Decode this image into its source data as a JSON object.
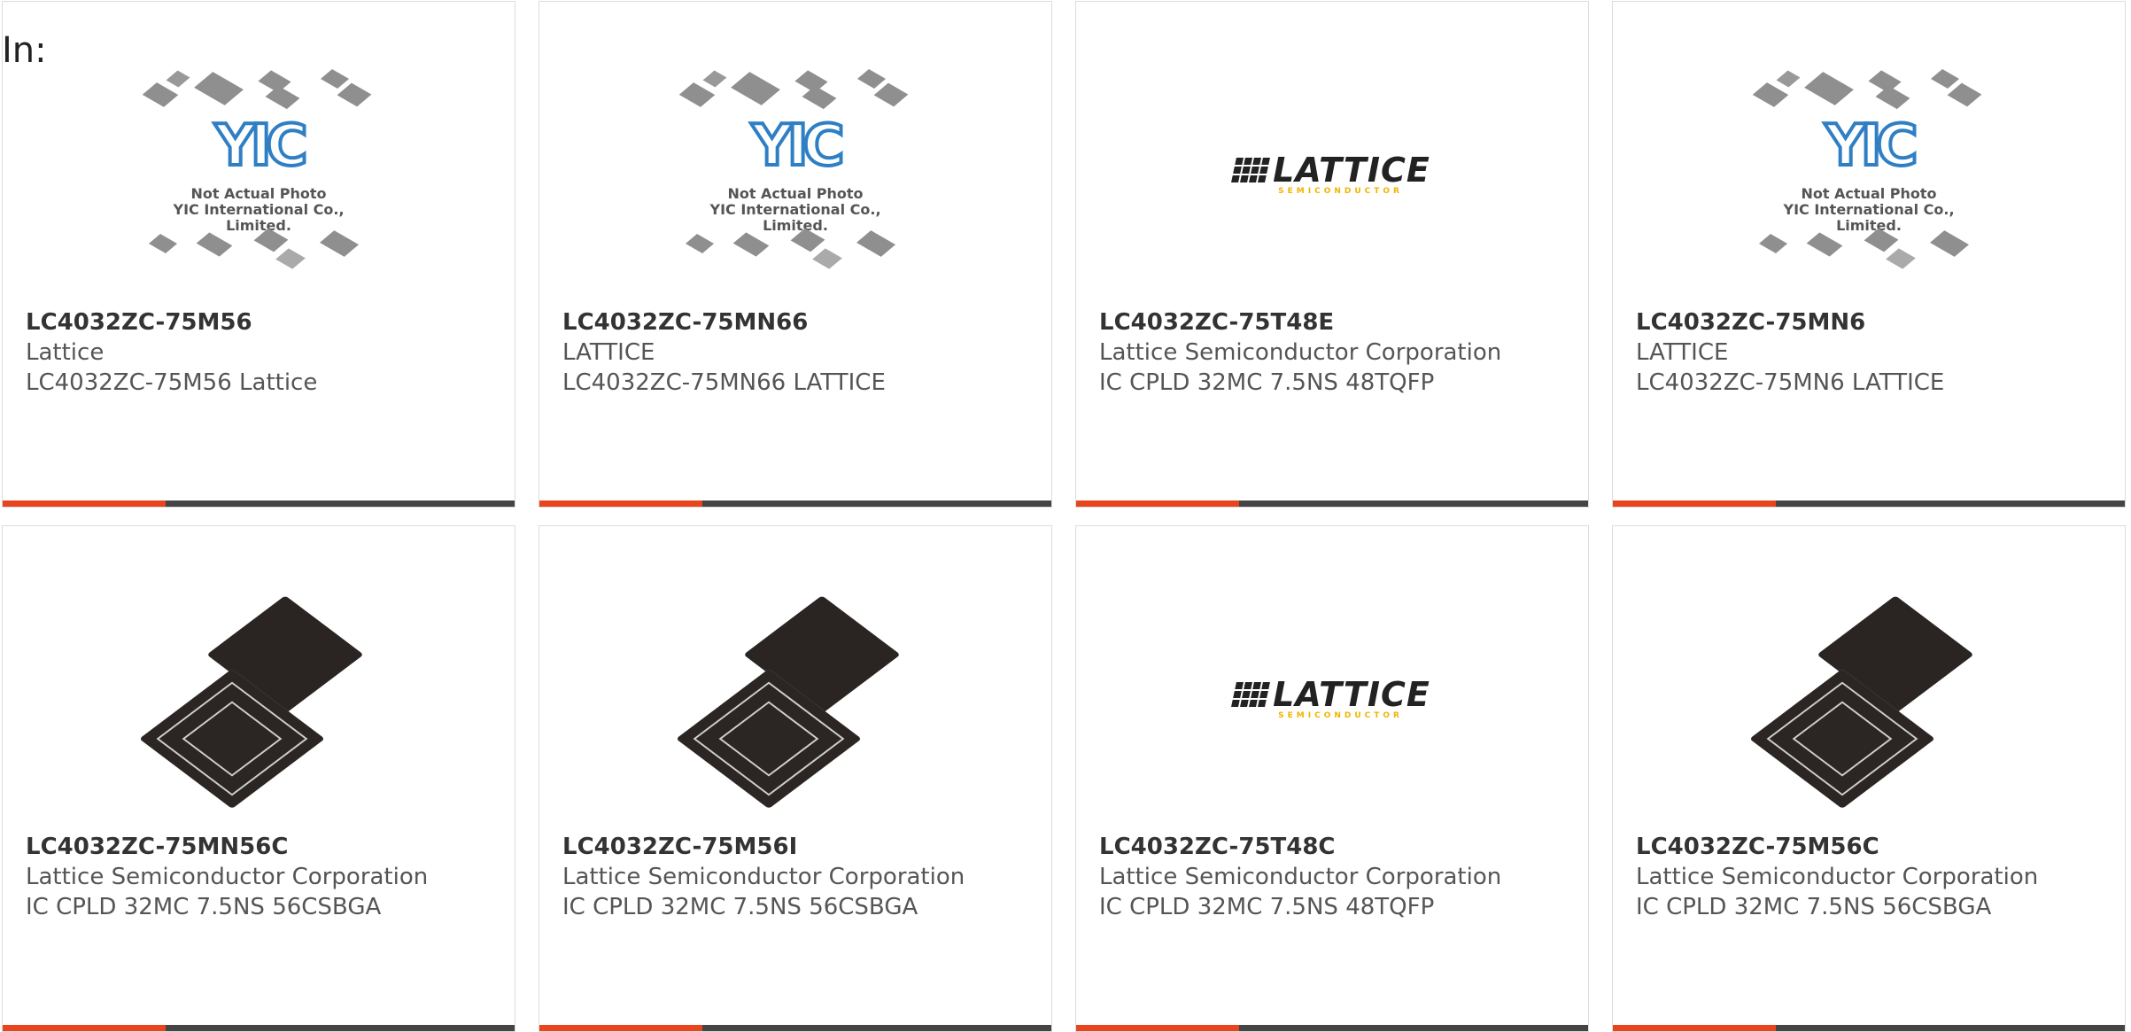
{
  "header": {
    "label": "In:"
  },
  "placeholder": {
    "line1": "Not Actual Photo",
    "line2": "YIC International Co., Limited."
  },
  "brand": {
    "accent": "#e8451e",
    "bar": "#444444",
    "lattice_yellow": "#f0b400"
  },
  "products": [
    {
      "part": "LC4032ZC-75M56",
      "maker": "Lattice",
      "desc": "LC4032ZC-75M56 Lattice",
      "image": "yic-placeholder"
    },
    {
      "part": "LC4032ZC-75MN66",
      "maker": "LATTICE",
      "desc": "LC4032ZC-75MN66 LATTICE",
      "image": "yic-placeholder"
    },
    {
      "part": "LC4032ZC-75T48E",
      "maker": "Lattice Semiconductor Corporation",
      "desc": "IC CPLD 32MC 7.5NS 48TQFP",
      "image": "lattice-logo"
    },
    {
      "part": "LC4032ZC-75MN6",
      "maker": "LATTICE",
      "desc": "LC4032ZC-75MN6 LATTICE",
      "image": "yic-placeholder"
    },
    {
      "part": "LC4032ZC-75MN56C",
      "maker": "Lattice Semiconductor Corporation",
      "desc": "IC CPLD 32MC 7.5NS 56CSBGA",
      "image": "bga-chip"
    },
    {
      "part": "LC4032ZC-75M56I",
      "maker": "Lattice Semiconductor Corporation",
      "desc": "IC CPLD 32MC 7.5NS 56CSBGA",
      "image": "bga-chip"
    },
    {
      "part": "LC4032ZC-75T48C",
      "maker": "Lattice Semiconductor Corporation",
      "desc": "IC CPLD 32MC 7.5NS 48TQFP",
      "image": "lattice-logo"
    },
    {
      "part": "LC4032ZC-75M56C",
      "maker": "Lattice Semiconductor Corporation",
      "desc": "IC CPLD 32MC 7.5NS 56CSBGA",
      "image": "bga-chip"
    }
  ],
  "lattice_logo": {
    "word": "LATTICE",
    "sub": "SEMICONDUCTOR"
  },
  "yic_mark": "YIC"
}
